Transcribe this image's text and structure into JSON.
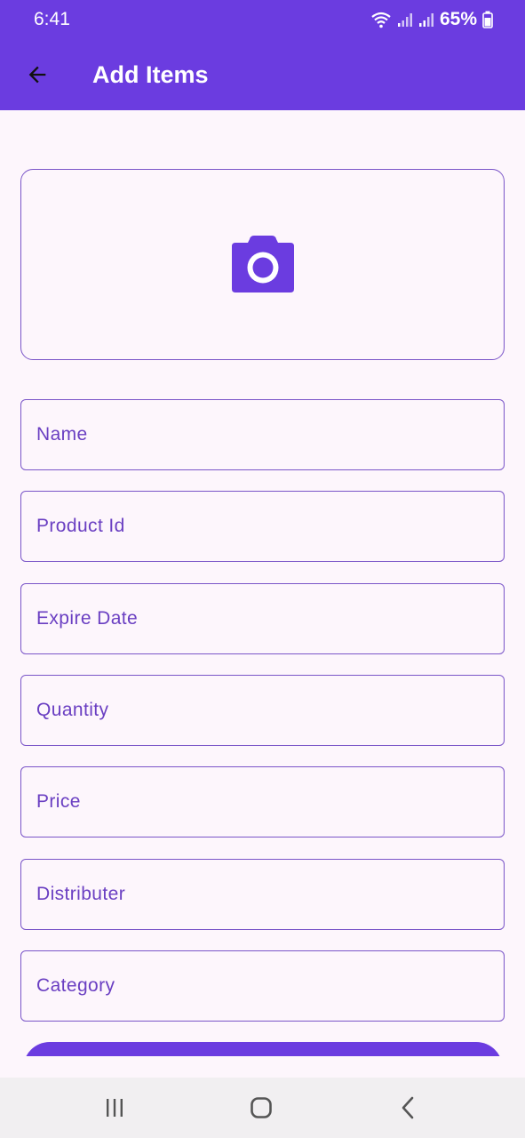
{
  "status_bar": {
    "time": "6:41",
    "battery": "65%"
  },
  "app_bar": {
    "title": "Add Items"
  },
  "image_picker": {
    "icon": "camera-icon"
  },
  "form": {
    "fields": [
      {
        "label": "Name"
      },
      {
        "label": "Product Id"
      },
      {
        "label": "Expire Date"
      },
      {
        "label": "Quantity"
      },
      {
        "label": "Price"
      },
      {
        "label": "Distributer"
      },
      {
        "label": "Category"
      }
    ]
  },
  "colors": {
    "primary": "#6b3ce0",
    "background": "#fdf6fc",
    "field_border": "#7a55c8",
    "label": "#6a3fc2"
  }
}
